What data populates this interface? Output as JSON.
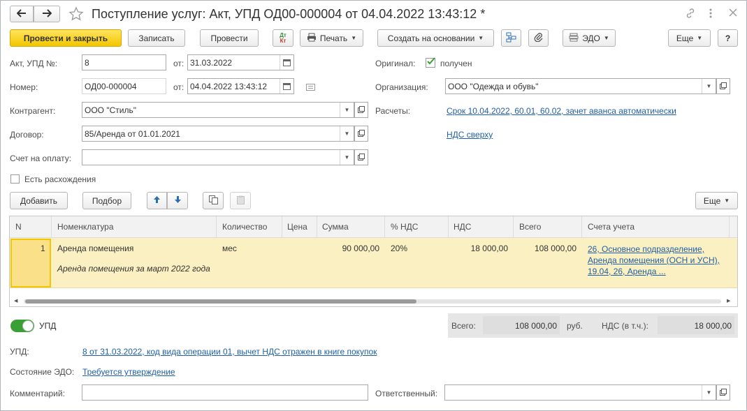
{
  "window": {
    "title": "Поступление услуг: Акт, УПД ОД00-000004 от 04.04.2022 13:43:12 *"
  },
  "toolbar": {
    "post_close": "Провести и закрыть",
    "save": "Записать",
    "post": "Провести",
    "dt_kt": "Дт Кт",
    "print": "Печать",
    "create_based": "Создать на основании",
    "edo": "ЭДО",
    "more": "Еще",
    "help": "?"
  },
  "form": {
    "act_label": "Акт, УПД №:",
    "act_value": "8",
    "from_label": "от:",
    "act_date": "31.03.2022",
    "number_label": "Номер:",
    "number_value": "ОД00-000004",
    "from_label2": "от:",
    "number_date": "04.04.2022 13:43:12",
    "contractor_label": "Контрагент:",
    "contractor_value": "ООО \"Стиль\"",
    "contract_label": "Договор:",
    "contract_value": "85/Аренда от 01.01.2021",
    "invoice_label": "Счет на оплату:",
    "invoice_value": "",
    "discrepancy_label": "Есть расхождения",
    "original_label": "Оригинал:",
    "original_checkbox": "получен",
    "org_label": "Организация:",
    "org_value": "ООО \"Одежда и обувь\"",
    "settlements_label": "Расчеты:",
    "settlements_link": "Срок 10.04.2022, 60.01, 60.02, зачет аванса автоматически",
    "vat_link": "НДС сверху"
  },
  "table_toolbar": {
    "add": "Добавить",
    "select": "Подбор",
    "more": "Еще"
  },
  "table": {
    "headers": [
      "N",
      "Номенклатура",
      "Количество",
      "Цена",
      "Сумма",
      "% НДС",
      "НДС",
      "Всего",
      "Счета учета"
    ],
    "rows": [
      {
        "n": "1",
        "item": "Аренда помещения",
        "item_note": "Аренда помещения за март 2022 года",
        "unit": "мес",
        "price": "",
        "sum": "90 000,00",
        "vat_rate": "20%",
        "vat": "18 000,00",
        "total": "108 000,00",
        "accounts": "26, Основное подразделение, Аренда помещения (ОСН и УСН), 19.04, 26, Аренда ..."
      }
    ]
  },
  "footer": {
    "upd_toggle": "УПД",
    "total_label": "Всего:",
    "total_value": "108 000,00",
    "currency": "руб.",
    "vat_label": "НДС (в т.ч.):",
    "vat_value": "18 000,00",
    "upd_label": "УПД:",
    "upd_link": "8 от 31.03.2022, код вида операции 01, вычет НДС отражен в книге покупок",
    "edo_state_label": "Состояние ЭДО:",
    "edo_state_link": "Требуется утверждение",
    "comment_label": "Комментарий:",
    "comment_value": "",
    "responsible_label": "Ответственный:",
    "responsible_value": ""
  },
  "colors": {
    "accent_yellow": "#f3c600",
    "row_highlight": "#fbf0c1",
    "link_blue": "#1f5fa8",
    "toggle_green": "#3aa035"
  }
}
